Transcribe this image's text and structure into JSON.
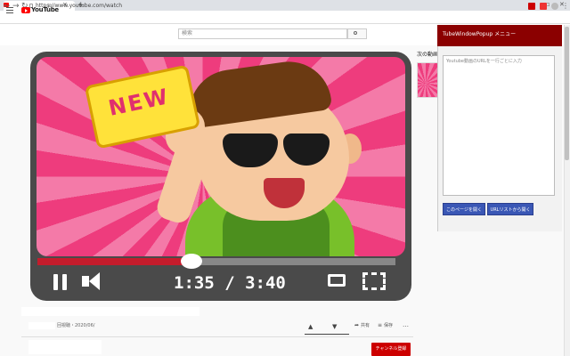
{
  "browser": {
    "new_tab": "+",
    "url": "https://www.youtube.com/watch",
    "window_controls": [
      "–",
      "▫",
      "✕"
    ],
    "tab_close": "×",
    "nav": {
      "back": "←",
      "forward": "→",
      "reload": "↻"
    },
    "menu": "⋮"
  },
  "masthead": {
    "logo_text": "YouTube",
    "logo_region": "JP",
    "search_placeholder": "検索"
  },
  "player": {
    "sticker_text": "NEW",
    "timecode": "1:35 / 3:40",
    "progress": 0.43
  },
  "video_meta": {
    "views_date": "回視聴・2020/06/",
    "share": "共有",
    "save": "保存",
    "more": "…",
    "like_icon": "like-icon",
    "dislike_icon": "dislike-icon",
    "subscribe": "チャンネル登録"
  },
  "sidebar": {
    "next_label": "次の動画"
  },
  "popup": {
    "title": "TubeWindowPopup メニュー",
    "textarea_placeholder": "Youtube動画のURLを一行ごとに入力",
    "open_page_button": "このページを開く",
    "open_list_button": "URLリストから開く"
  },
  "colors": {
    "popup_header": "#8b0000",
    "button": "#3a57b5",
    "subscribe": "#cc0000",
    "progress": "#c41c2c"
  }
}
